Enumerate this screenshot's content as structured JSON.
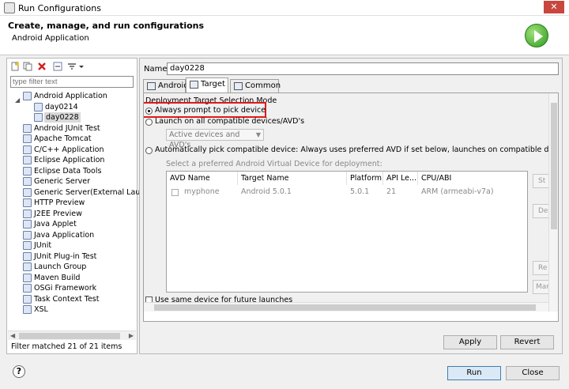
{
  "window": {
    "title": "Run Configurations",
    "close_glyph": "✕"
  },
  "header": {
    "title": "Create, manage, and run configurations",
    "subtitle": "Android Application"
  },
  "left": {
    "filter_placeholder": "type filter text",
    "tree": [
      {
        "label": "Android Application",
        "level": 1,
        "icon": "android-app-icon"
      },
      {
        "label": "day0214",
        "level": 2,
        "icon": "config-icon"
      },
      {
        "label": "day0228",
        "level": 2,
        "icon": "config-icon",
        "selected": true
      },
      {
        "label": "Android JUnit Test",
        "level": 1,
        "icon": "junit-icon"
      },
      {
        "label": "Apache Tomcat",
        "level": 1,
        "icon": "tomcat-icon"
      },
      {
        "label": "C/C++ Application",
        "level": 1,
        "icon": "cpp-icon"
      },
      {
        "label": "Eclipse Application",
        "level": 1,
        "icon": "eclipse-icon"
      },
      {
        "label": "Eclipse Data Tools",
        "level": 1,
        "icon": "data-tools-icon"
      },
      {
        "label": "Generic Server",
        "level": 1,
        "icon": "server-icon"
      },
      {
        "label": "Generic Server(External Launch",
        "level": 1,
        "icon": "server-icon"
      },
      {
        "label": "HTTP Preview",
        "level": 1,
        "icon": "server-icon"
      },
      {
        "label": "J2EE Preview",
        "level": 1,
        "icon": "server-icon"
      },
      {
        "label": "Java Applet",
        "level": 1,
        "icon": "applet-icon"
      },
      {
        "label": "Java Application",
        "level": 1,
        "icon": "java-app-icon"
      },
      {
        "label": "JUnit",
        "level": 1,
        "icon": "junit-icon"
      },
      {
        "label": "JUnit Plug-in Test",
        "level": 1,
        "icon": "junit-icon"
      },
      {
        "label": "Launch Group",
        "level": 1,
        "icon": "launch-group-icon"
      },
      {
        "label": "Maven Build",
        "level": 1,
        "icon": "maven-icon"
      },
      {
        "label": "OSGi Framework",
        "level": 1,
        "icon": "osgi-icon"
      },
      {
        "label": "Task Context Test",
        "level": 1,
        "icon": "junit-icon"
      },
      {
        "label": "XSL",
        "level": 1,
        "icon": "xsl-icon"
      }
    ],
    "matched": "Filter matched 21 of 21 items"
  },
  "right": {
    "name_label": "Name:",
    "name_value": "day0228",
    "tabs": [
      "Android",
      "Target",
      "Common"
    ],
    "active_tab": "Target",
    "section_title": "Deployment Target Selection Mode",
    "radio_always": "Always prompt to pick device",
    "radio_launch_all": "Launch on all compatible devices/AVD's",
    "combo_value": "Active devices and AVD's",
    "radio_auto": "Automatically pick compatible device: Always uses preferred AVD if set below, launches on compatible device/AVD otherwise.",
    "hint": "Select a preferred Android Virtual Device for deployment:",
    "table": {
      "columns": [
        "AVD Name",
        "Target Name",
        "Platform",
        "API Le...",
        "CPU/ABI"
      ],
      "rows": [
        [
          "myphone",
          "Android 5.0.1",
          "5.0.1",
          "21",
          "ARM (armeabi-v7a)"
        ]
      ]
    },
    "side_buttons": [
      "St",
      "De",
      "Re",
      "Mar"
    ],
    "checkbox_label": "Use same device for future launches",
    "apply": "Apply",
    "revert": "Revert"
  },
  "footer": {
    "run": "Run",
    "close": "Close",
    "help": "?"
  }
}
